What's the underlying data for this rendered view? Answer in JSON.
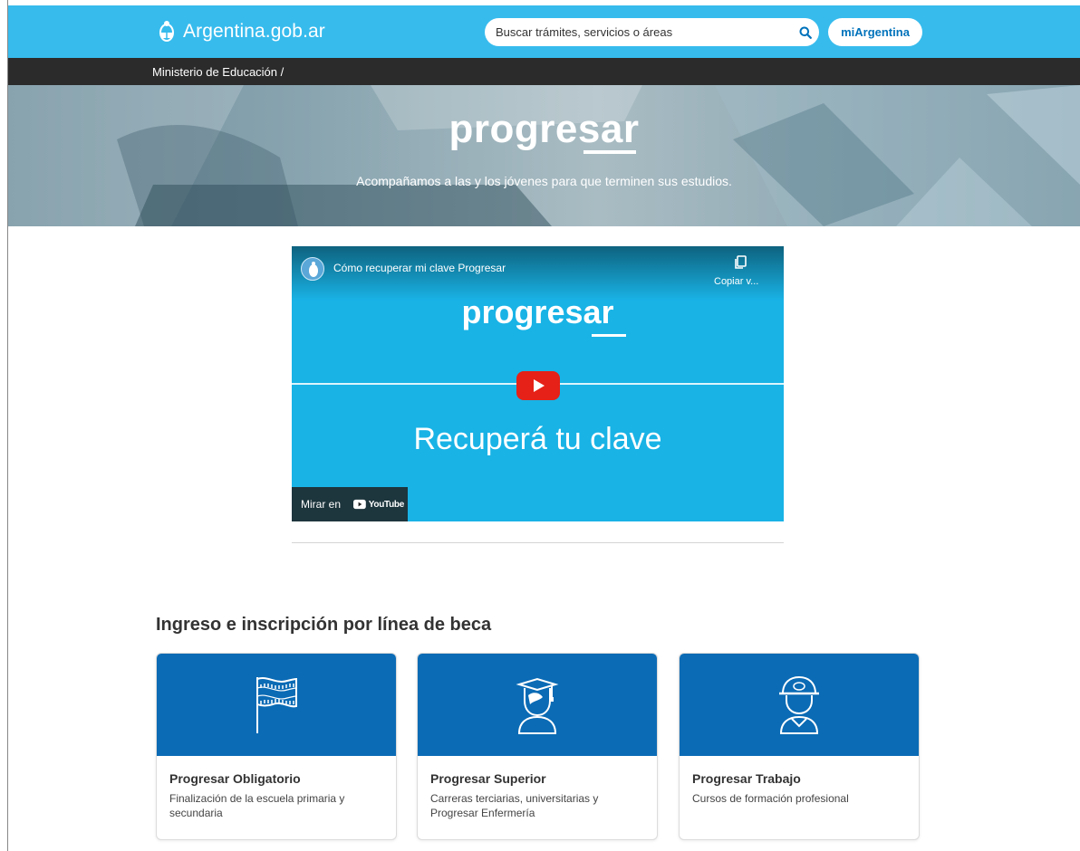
{
  "header": {
    "brand": "Argentina.gob.ar",
    "search_placeholder": "Buscar trámites, servicios o áreas",
    "account_button": "miArgentina"
  },
  "breadcrumb": {
    "text": "Ministerio de Educación /"
  },
  "hero": {
    "logo": "progresar",
    "subtitle": "Acompañamos a las y los jóvenes para que terminen sus estudios."
  },
  "video": {
    "title": "Cómo recuperar mi clave Progresar",
    "copy_label": "Copiar v...",
    "logo": "progresar",
    "heading": "Recuperá tu clave",
    "watch_on": "Mirar en",
    "youtube": "YouTube"
  },
  "section": {
    "title": "Ingreso e inscripción por línea de beca",
    "cards": [
      {
        "title": "Progresar Obligatorio",
        "description": "Finalización de la escuela primaria y secundaria",
        "icon": "flag-icon"
      },
      {
        "title": "Progresar Superior",
        "description": "Carreras terciarias, universitarias y Progresar Enfermería",
        "icon": "graduate-icon"
      },
      {
        "title": "Progresar Trabajo",
        "description": "Cursos de formación profesional",
        "icon": "worker-helmet-icon"
      }
    ]
  },
  "colors": {
    "header_bg": "#37bbed",
    "breadcrumb_bg": "#2b2b2b",
    "card_media_bg": "#0b6bb5",
    "accent": "#0072bb",
    "video_bg": "#19b3e6",
    "play_red": "#e62117"
  }
}
